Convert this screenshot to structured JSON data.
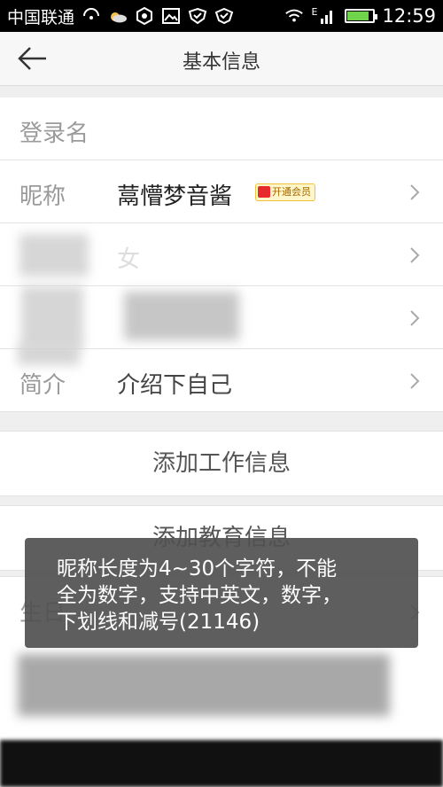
{
  "status_bar": {
    "carrier": "中国联通",
    "time": "12:59",
    "battery_level": 0.85,
    "icons": [
      "hd-call-icon",
      "weather-cloud-icon",
      "settings-hex-icon",
      "image-icon",
      "shield-icon",
      "vpn-icon",
      "wifi-icon",
      "signal-icon",
      "battery-charging-icon"
    ],
    "network_tag": "E"
  },
  "header": {
    "title": "基本信息"
  },
  "rows": [
    {
      "label": "登录名",
      "value": ""
    },
    {
      "label": "昵称",
      "value": "蒚懵梦音酱",
      "badge": "开通会员"
    },
    {
      "label": "",
      "value": "女"
    },
    {
      "label": "",
      "value": ""
    },
    {
      "label": "简介",
      "value": "介绍下自己"
    }
  ],
  "actions": {
    "work": "添加工作信息",
    "education": "添加教育信息"
  },
  "lower_row": {
    "label": "生日"
  },
  "toast": {
    "line1": "昵称长度为4~30个字符，不能",
    "line2": "全为数字，支持中英文，数字，",
    "line3": "下划线和减号(21146)"
  },
  "colors": {
    "accent_battery": "#6fd34b",
    "badge_bg": "#fff7c9",
    "badge_border": "#f0c23b"
  }
}
